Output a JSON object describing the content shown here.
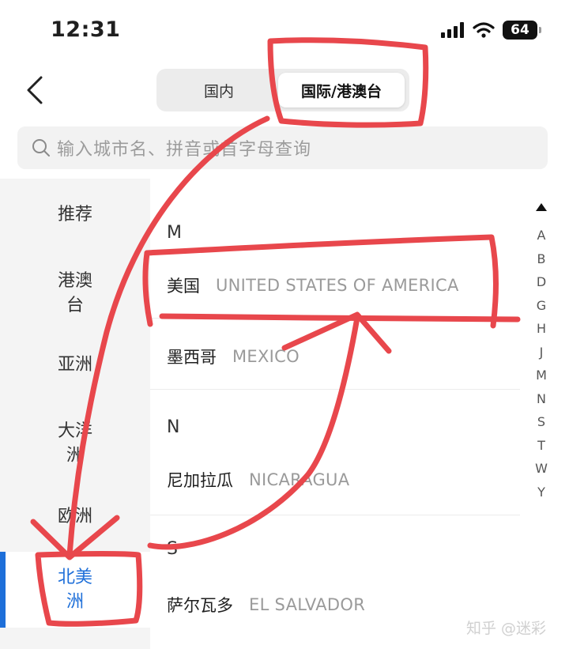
{
  "status": {
    "time": "12:31",
    "battery": "64"
  },
  "nav": {
    "tabs": [
      {
        "label": "国内"
      },
      {
        "label": "国际/港澳台"
      }
    ]
  },
  "search": {
    "placeholder": "输入城市名、拼音或首字母查询"
  },
  "sidebar": {
    "items": [
      {
        "label": "推荐"
      },
      {
        "label": "港澳台"
      },
      {
        "label": "亚洲"
      },
      {
        "label": "大洋洲"
      },
      {
        "label": "欧洲"
      },
      {
        "label": "北美洲"
      }
    ]
  },
  "list": {
    "sections": [
      {
        "letter": "M",
        "rows": [
          {
            "cn": "美国",
            "en": "UNITED STATES OF AMERICA"
          },
          {
            "cn": "墨西哥",
            "en": "MEXICO"
          }
        ]
      },
      {
        "letter": "N",
        "rows": [
          {
            "cn": "尼加拉瓜",
            "en": "NICARAGUA"
          }
        ]
      },
      {
        "letter": "S",
        "rows": [
          {
            "cn": "萨尔瓦多",
            "en": "EL SALVADOR"
          }
        ]
      }
    ]
  },
  "index": {
    "letters": [
      "A",
      "B",
      "D",
      "G",
      "H",
      "J",
      "M",
      "N",
      "S",
      "T",
      "W",
      "Y"
    ]
  },
  "watermark": "知乎 @迷彩",
  "colors": {
    "accent": "#1e6fd9",
    "annotation": "#e8474c"
  }
}
